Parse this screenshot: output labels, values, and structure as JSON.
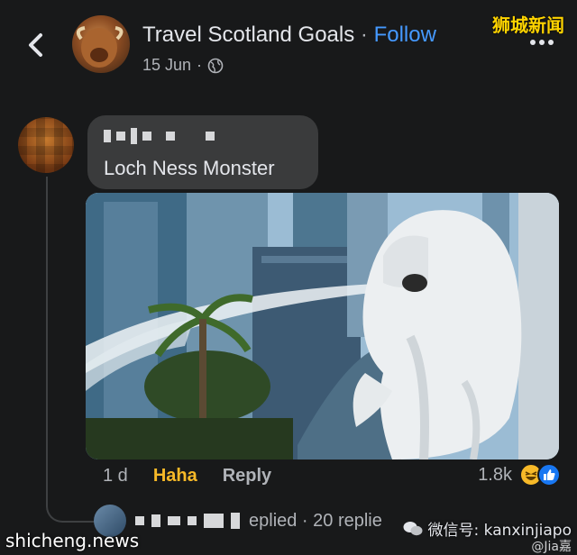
{
  "header": {
    "page_name": "Travel Scotland Goals",
    "separator": "·",
    "follow_label": "Follow",
    "date": "15 Jun",
    "date_sep": "·",
    "watermark": "狮城新闻"
  },
  "comment": {
    "text": "Loch Ness Monster",
    "time": "1 d",
    "reaction_label": "Haha",
    "reply_label": "Reply",
    "reaction_count": "1.8k"
  },
  "replies": {
    "summary": "eplied · 20 replie"
  },
  "watermarks": {
    "bottom_left": "shicheng.news",
    "wechat": "微信号: kanxinjiapo",
    "handle": "@Jia嘉"
  },
  "colors": {
    "background": "#18191a",
    "bubble": "#3a3b3c",
    "follow": "#4599ff",
    "haha": "#f7b928",
    "like": "#1877f2"
  },
  "icons": [
    "back-icon",
    "globe-icon",
    "more-icon",
    "haha-reaction-icon",
    "like-reaction-icon",
    "wechat-icon"
  ]
}
